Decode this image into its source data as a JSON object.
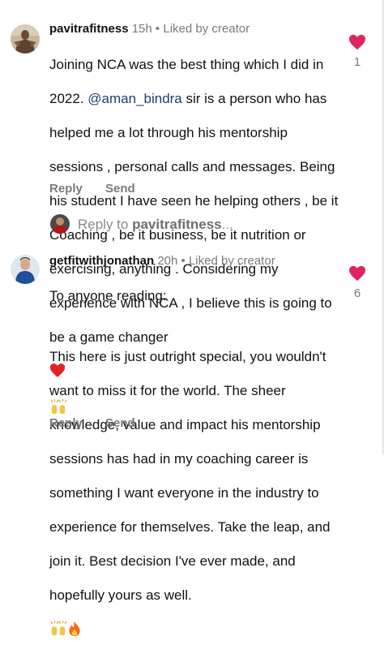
{
  "colors": {
    "text": "#111111",
    "muted": "#7a7a7a",
    "mention": "#1f3f72",
    "like": "#e0245e"
  },
  "comments": [
    {
      "username": "pavitrafitness",
      "time": "15h",
      "liked_by": "Liked by creator",
      "separator": "•",
      "lines": [
        {
          "prefix": "Joining NCA was the best thing which I did in",
          "mention": "",
          "suffix": ""
        },
        {
          "prefix": "2022. ",
          "mention": "@aman_bindra",
          "suffix": " sir is a person who has"
        },
        {
          "prefix": "helped me a lot through his mentorship",
          "mention": "",
          "suffix": ""
        },
        {
          "prefix": "sessions , personal calls and messages.  Being",
          "mention": "",
          "suffix": ""
        },
        {
          "prefix": "his student I have seen he helping others , be it",
          "mention": "",
          "suffix": ""
        },
        {
          "prefix": "Coaching , be it business, be it nutrition or",
          "mention": "",
          "suffix": ""
        },
        {
          "prefix": "exercising, anything . Considering my",
          "mention": "",
          "suffix": ""
        },
        {
          "prefix": "experience with NCA , I believe this is going to",
          "mention": "",
          "suffix": ""
        },
        {
          "prefix": "be a game changer",
          "mention": "",
          "suffix": ""
        }
      ],
      "emojis": [
        "red-heart",
        "raising-hands"
      ],
      "reply_label": "Reply",
      "send_label": "Send",
      "like_count": "1"
    },
    {
      "username": "getfitwithjonathan",
      "time": "20h",
      "liked_by": "Liked by creator",
      "separator": "•",
      "lines": [
        {
          "prefix": "To anyone reading:",
          "mention": "",
          "suffix": ""
        },
        {
          "prefix": "",
          "mention": "",
          "suffix": ""
        },
        {
          "prefix": "This here is just outright special, you wouldn't",
          "mention": "",
          "suffix": ""
        },
        {
          "prefix": "want to miss it for the world. The sheer",
          "mention": "",
          "suffix": ""
        },
        {
          "prefix": "knowledge, value and impact his mentorship",
          "mention": "",
          "suffix": ""
        },
        {
          "prefix": "sessions has had in my coaching career is",
          "mention": "",
          "suffix": ""
        },
        {
          "prefix": "something I want everyone in the industry to",
          "mention": "",
          "suffix": ""
        },
        {
          "prefix": "experience for themselves. Take the leap, and",
          "mention": "",
          "suffix": ""
        },
        {
          "prefix": "join it. Best decision I've ever made, and",
          "mention": "",
          "suffix": ""
        },
        {
          "prefix": "hopefully yours as well.",
          "mention": "",
          "suffix": ""
        }
      ],
      "emojis": [
        "raising-hands",
        "fire"
      ],
      "reply_label": "Reply",
      "send_label": "Send",
      "like_count": "6"
    }
  ],
  "reply_prompt": {
    "prefix": "Reply to ",
    "username": "pavitrafitness",
    "ellipsis": "..."
  }
}
